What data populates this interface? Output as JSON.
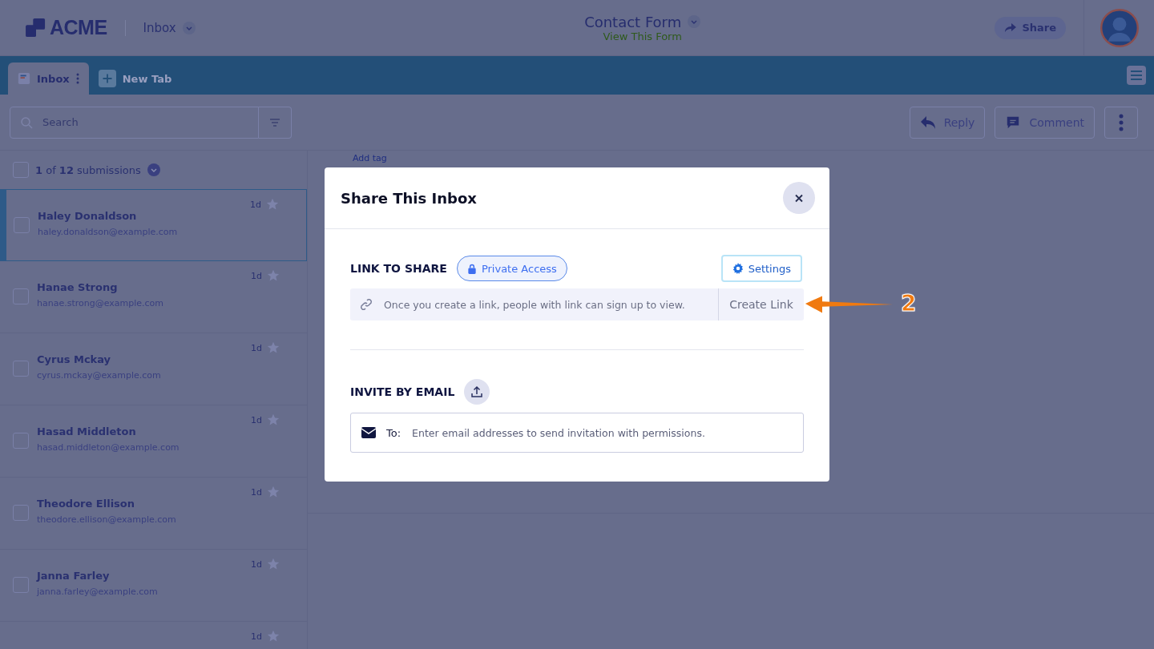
{
  "header": {
    "logo": "ACME",
    "inbox_menu": "Inbox",
    "form_title": "Contact Form",
    "form_link": "View This Form",
    "share_button": "Share"
  },
  "tabs": [
    {
      "label": "Inbox",
      "selected": true,
      "kind": "inbox"
    },
    {
      "label": "New Tab",
      "selected": false,
      "kind": "new"
    }
  ],
  "toolbar": {
    "search": {
      "placeholder": "Search"
    },
    "buttons": [
      {
        "label": "Reply",
        "kind": "reply"
      },
      {
        "label": "Comment",
        "kind": "comment"
      }
    ]
  },
  "list": {
    "summary": "**1** of **12** submissions",
    "select_all_checked": false,
    "items": [
      {
        "name": "Haley Donaldson",
        "email": "haley.donaldson@example.com",
        "time": "1d",
        "selected": true,
        "checked": false,
        "starred": false
      },
      {
        "name": "Hanae Strong",
        "email": "hanae.strong@example.com",
        "time": "1d",
        "selected": false,
        "checked": false,
        "starred": false
      },
      {
        "name": "Cyrus Mckay",
        "email": "cyrus.mckay@example.com",
        "time": "1d",
        "selected": false,
        "checked": false,
        "starred": false
      },
      {
        "name": "Hasad Middleton",
        "email": "hasad.middleton@example.com",
        "time": "1d",
        "selected": false,
        "checked": false,
        "starred": false
      },
      {
        "name": "Theodore Ellison",
        "email": "theodore.ellison@example.com",
        "time": "1d",
        "selected": false,
        "checked": false,
        "starred": false
      },
      {
        "name": "Janna Farley",
        "email": "janna.farley@example.com",
        "time": "1d",
        "selected": false,
        "checked": false,
        "starred": false
      },
      {
        "time": "1d",
        "selected": false,
        "starred": false
      }
    ]
  },
  "detail": {
    "add_tag": "Add tag"
  },
  "modal": {
    "title": "Share This Inbox",
    "link_heading": "LINK TO SHARE",
    "access_badge": "Private Access",
    "settings_button": "Settings",
    "link_hint": "Once you create a link, people with link can sign up to view.",
    "create_button": "Create Link",
    "invite_heading": "INVITE BY EMAIL",
    "to_label": "To:",
    "email_placeholder": "Enter email addresses to send invitation with permissions."
  },
  "annotation": {
    "label": "2"
  }
}
